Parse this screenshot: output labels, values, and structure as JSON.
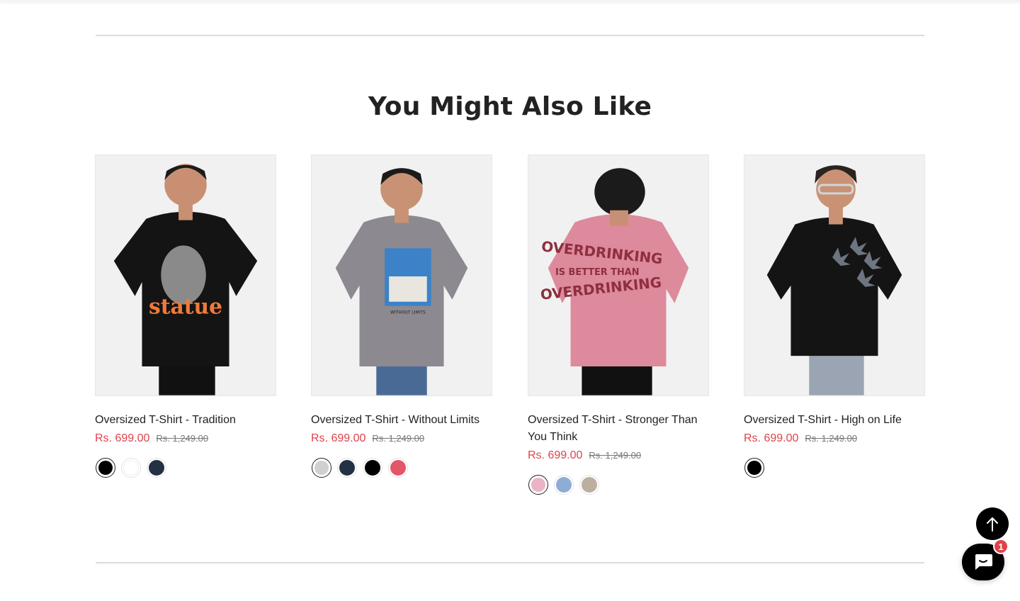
{
  "section": {
    "title": "You Might Also Like"
  },
  "products": [
    {
      "name": "Oversized T-Shirt - Tradition",
      "price": "Rs. 699.00",
      "compare_price": "Rs. 1,249.00",
      "image_icon": "product-photo-black-statue-tee",
      "shirt_color": "#141414",
      "swatches": [
        {
          "name": "black",
          "color": "#000000",
          "active": true
        },
        {
          "name": "white",
          "color": "#ffffff",
          "active": false
        },
        {
          "name": "navy",
          "color": "#243044",
          "active": false
        }
      ]
    },
    {
      "name": "Oversized T-Shirt - Without Limits",
      "price": "Rs. 699.00",
      "compare_price": "Rs. 1,249.00",
      "image_icon": "product-photo-grey-without-limits-tee",
      "shirt_color": "#8c8a90",
      "swatches": [
        {
          "name": "light-grey",
          "color": "#d0d0d2",
          "active": true
        },
        {
          "name": "navy",
          "color": "#243044",
          "active": false
        },
        {
          "name": "black",
          "color": "#000000",
          "active": false
        },
        {
          "name": "coral",
          "color": "#e2566a",
          "active": false
        }
      ]
    },
    {
      "name": "Oversized T-Shirt - Stronger Than You Think",
      "price": "Rs. 699.00",
      "compare_price": "Rs. 1,249.00",
      "image_icon": "product-photo-pink-overdrinking-tee",
      "shirt_color": "#dd8a9c",
      "swatches": [
        {
          "name": "pink",
          "color": "#e9b4c4",
          "active": true
        },
        {
          "name": "sky-blue",
          "color": "#8fadd4",
          "active": false
        },
        {
          "name": "beige",
          "color": "#bdaf9f",
          "active": false
        }
      ]
    },
    {
      "name": "Oversized T-Shirt - High on Life",
      "price": "Rs. 699.00",
      "compare_price": "Rs. 1,249.00",
      "image_icon": "product-photo-black-high-on-life-tee",
      "shirt_color": "#141414",
      "swatches": [
        {
          "name": "black",
          "color": "#000000",
          "active": true
        }
      ]
    }
  ],
  "widgets": {
    "back_to_top_icon": "arrow-up-icon",
    "chat_icon": "chat-bubble-icon",
    "chat_badge": "1"
  }
}
